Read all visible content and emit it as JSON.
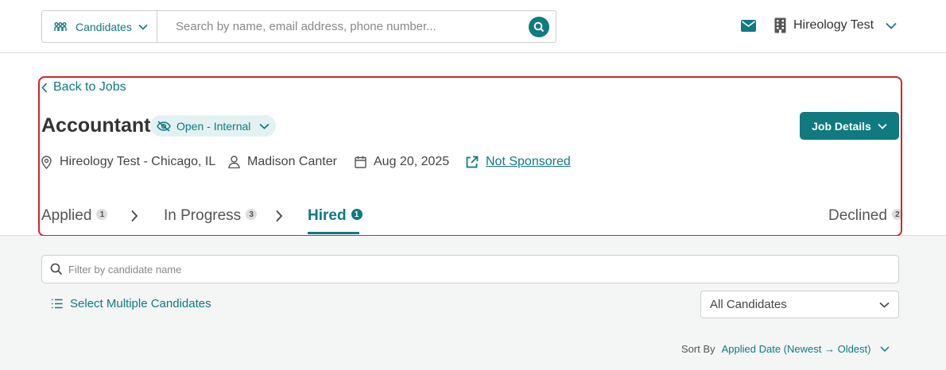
{
  "topbar": {
    "scope_label": "Candidates",
    "search_placeholder": "Search by name, email address, phone number...",
    "org_name": "Hireology Test"
  },
  "job": {
    "back_label": "Back to Jobs",
    "title": "Accountant",
    "status": "Open - Internal",
    "details_button": "Job Details",
    "location": "Hireology Test - Chicago, IL",
    "owner": "Madison Canter",
    "date": "Aug 20, 2025",
    "sponsorship": "Not Sponsored"
  },
  "tabs": [
    {
      "label": "Applied",
      "count": "1"
    },
    {
      "label": "In Progress",
      "count": "3"
    },
    {
      "label": "Hired",
      "count": "1",
      "active": true
    },
    {
      "label": "Declined",
      "count": "2"
    }
  ],
  "list": {
    "filter_placeholder": "Filter by candidate name",
    "select_multiple": "Select Multiple Candidates",
    "dropdown_value": "All Candidates",
    "sort_label": "Sort By",
    "sort_value": "Applied Date (Newest → Oldest)"
  },
  "colors": {
    "accent": "#0f7a80",
    "highlight": "#d0242f"
  },
  "icons": {
    "scope": "people-icon",
    "search": "search-icon",
    "mail": "mail-icon",
    "org": "building-icon",
    "back": "chevron-left-icon",
    "status": "eye-slash-icon",
    "location": "map-pin-icon",
    "owner": "user-icon",
    "date": "calendar-icon",
    "sponsor": "external-link-icon",
    "filter": "search-icon",
    "select": "list-icon"
  }
}
